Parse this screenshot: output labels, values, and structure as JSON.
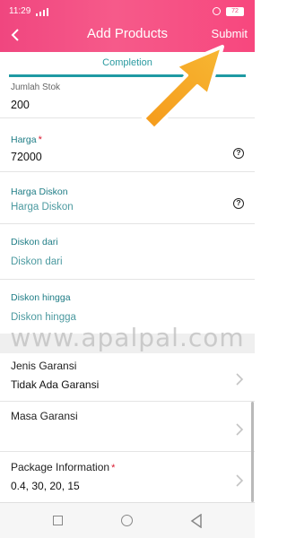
{
  "status_bar": {
    "time": "11:29",
    "battery": "72"
  },
  "appbar": {
    "title": "Add Products",
    "submit_label": "Submit",
    "color": "#f0467f"
  },
  "tabs": {
    "active_label": "Completion",
    "indicator_color": "#1f9aa3"
  },
  "form": {
    "stock": {
      "label": "Jumlah Stok",
      "value": "200"
    },
    "price": {
      "label": "Harga",
      "value": "72000",
      "required": true
    },
    "discount_price": {
      "label": "Harga Diskon",
      "placeholder": "Harga Diskon"
    },
    "discount_from": {
      "label": "Diskon dari",
      "placeholder": "Diskon dari"
    },
    "discount_to": {
      "label": "Diskon hingga",
      "placeholder": "Diskon hingga"
    }
  },
  "rows": {
    "warranty_type": {
      "label": "Jenis Garansi",
      "value": "Tidak Ada Garansi"
    },
    "warranty_period": {
      "label": "Masa Garansi",
      "value": ""
    },
    "package_info": {
      "label": "Package Information",
      "value": "0.4, 30, 20, 15",
      "required": true
    }
  },
  "watermark": "www.apalpal.com",
  "icons": {
    "back": "back-arrow-icon",
    "help": "question-circle-icon",
    "chevron": "chevron-right-icon",
    "nav_recent": "square-icon",
    "nav_home": "circle-icon",
    "nav_back": "triangle-back-icon",
    "pointer": "orange-arrow-icon"
  },
  "colors": {
    "accent_teal": "#1f9aa3",
    "required_star": "#d9192f",
    "arrow_orange": "#f7931e"
  }
}
